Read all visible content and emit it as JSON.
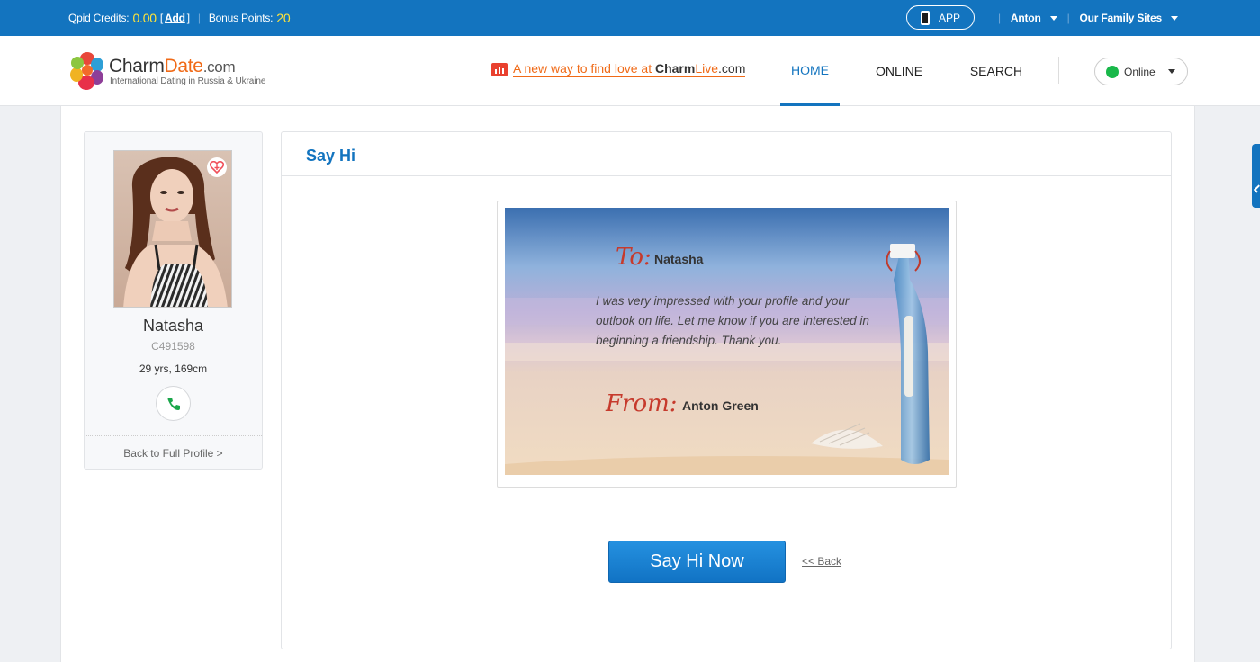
{
  "topbar": {
    "credits_label": "Qpid Credits:",
    "credits_value": "0.00",
    "bracket_open": "[",
    "add_label": "Add",
    "bracket_close": "]",
    "divider": "|",
    "bonus_label": "Bonus Points:",
    "bonus_value": "20",
    "app_label": "APP",
    "user_name": "Anton",
    "family_sites": "Our Family Sites"
  },
  "header": {
    "brand_main": "Charm",
    "brand_accent": "Date",
    "brand_suffix": ".com",
    "tagline": "International Dating in Russia & Ukraine",
    "promo_prefix": "A new way to find love at ",
    "promo_brand": "Charm",
    "promo_brand_accent": "Live",
    "promo_suffix": ".com",
    "nav": {
      "home": "HOME",
      "online": "ONLINE",
      "search": "SEARCH"
    },
    "status": "Online"
  },
  "profile": {
    "name": "Natasha",
    "id": "C491598",
    "details": "29 yrs, 169cm",
    "back_link": "Back to Full Profile >"
  },
  "say_hi": {
    "title": "Say Hi",
    "to_label": "To:",
    "to_name": "Natasha",
    "message": "I was very impressed with your profile and your outlook on life. Let me know if you are interested in beginning a friendship. Thank you.",
    "from_label": "From:",
    "from_name": "Anton Green",
    "send_button": "Say Hi Now",
    "back_link": "<< Back"
  },
  "colors": {
    "brand_blue": "#1374bf",
    "brand_orange": "#f06a17",
    "online_green": "#19b84a",
    "credits_yellow": "#ffe43a",
    "script_red": "#c63a2c"
  }
}
